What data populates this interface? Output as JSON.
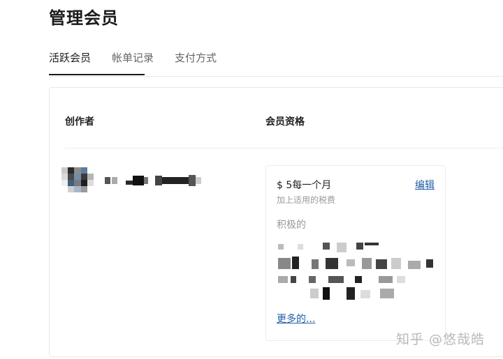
{
  "page": {
    "title": "管理会员"
  },
  "tabs": [
    {
      "label": "活跃会员",
      "active": true
    },
    {
      "label": "帐单记录",
      "active": false
    },
    {
      "label": "支付方式",
      "active": false
    }
  ],
  "table": {
    "headers": {
      "creator": "创作者",
      "membership": "会员资格"
    }
  },
  "creator": {
    "avatar_icon": "blurred-avatar-image",
    "name_obscured": true
  },
  "membership": {
    "price": "$ 5每一个月",
    "edit_label": "编辑",
    "tax_note": "加上适用的税费",
    "status": "积极的",
    "benefits_obscured": true,
    "more_label": "更多的..."
  },
  "watermark": {
    "text": "知乎 @悠哉皓"
  },
  "colors": {
    "link": "#1f5da8",
    "muted": "#999999",
    "border": "#e8e8e8",
    "text": "#222222"
  }
}
